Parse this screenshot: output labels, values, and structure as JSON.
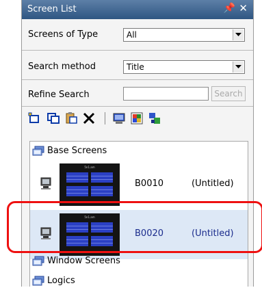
{
  "panel": {
    "title": "Screen List",
    "pin_icon": "pin-icon",
    "close_icon": "close-icon"
  },
  "filters": {
    "screens_of_type_label": "Screens of Type",
    "screens_of_type_value": "All",
    "search_method_label": "Search method",
    "search_method_value": "Title",
    "refine_search_label": "Refine Search",
    "refine_search_value": "",
    "search_button": "Search"
  },
  "toolbar": {
    "icons": [
      "new-screen-icon",
      "copy-screen-icon",
      "paste-screen-icon",
      "delete-icon",
      "screen-properties-icon",
      "screen-color-icon",
      "screen-layout-icon"
    ]
  },
  "tree": {
    "groups": [
      {
        "label": "Base Screens",
        "icon": "screens-folder-icon"
      },
      {
        "label": "Window Screens",
        "icon": "screens-folder-icon"
      },
      {
        "label": "Logics",
        "icon": "screens-folder-icon"
      }
    ],
    "items": [
      {
        "code": "B0010",
        "name": "(Untitled)",
        "thumb_title": "5n1.am",
        "selected": false
      },
      {
        "code": "B0020",
        "name": "(Untitled)",
        "thumb_title": "5n1.am",
        "selected": true
      }
    ]
  },
  "colors": {
    "titlebar": "#3e6591",
    "highlight": "#ee1010",
    "selection": "#dde8f6",
    "thumb_block": "#2b40c4"
  }
}
